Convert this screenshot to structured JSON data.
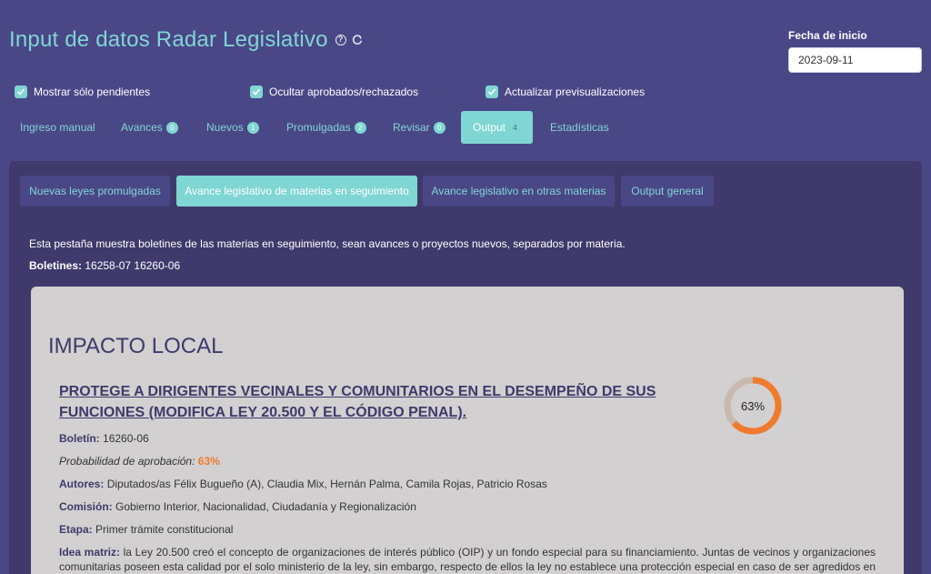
{
  "header": {
    "title": "Input de datos Radar Legislativo",
    "help_icon": "question-circle-icon",
    "refresh_icon": "refresh-icon"
  },
  "date": {
    "label": "Fecha de inicio",
    "value": "2023-09-11"
  },
  "checkboxes": [
    {
      "label": "Mostrar sólo pendientes",
      "checked": true
    },
    {
      "label": "Ocultar aprobados/rechazados",
      "checked": true
    },
    {
      "label": "Actualizar previsualizaciones",
      "checked": true
    }
  ],
  "tabs": [
    {
      "label": "Ingreso manual",
      "badge": null
    },
    {
      "label": "Avances",
      "badge": "0"
    },
    {
      "label": "Nuevos",
      "badge": "1"
    },
    {
      "label": "Promulgadas",
      "badge": "2"
    },
    {
      "label": "Revisar",
      "badge": "0"
    },
    {
      "label": "Output",
      "badge": "4",
      "active": true
    },
    {
      "label": "Estadísticas",
      "badge": null
    }
  ],
  "subtabs": [
    {
      "label": "Nuevas leyes promulgadas"
    },
    {
      "label": "Avance legislativo de materias en seguimiento",
      "active": true
    },
    {
      "label": "Avance legislativo en otras materias"
    },
    {
      "label": "Output general"
    }
  ],
  "output": {
    "description": "Esta pestaña muestra boletines de las materias en seguimiento, sean avances o proyectos nuevos, separados por materia.",
    "boletines_label": "Boletines:",
    "boletines_value": "16258-07 16260-06"
  },
  "card": {
    "heading": "IMPACTO LOCAL",
    "bill_title": "PROTEGE A DIRIGENTES VECINALES Y COMUNITARIOS EN EL DESEMPEÑO DE SUS FUNCIONES (MODIFICA LEY 20.500 Y EL CÓDIGO PENAL).",
    "boletin_label": "Boletín:",
    "boletin_value": "16260-06",
    "prob_label": "Probabilidad de aprobación:",
    "prob_value": "63%",
    "prob_fraction": 0.63,
    "donut_label": "63%",
    "autores_label": "Autores:",
    "autores_value": "Diputados/as Félix Bugueño (A), Claudia Mix, Hernán Palma, Camila Rojas, Patricio Rosas",
    "comision_label": "Comisión:",
    "comision_value": "Gobierno Interior, Nacionalidad, Ciudadanía y Regionalización",
    "etapa_label": "Etapa:",
    "etapa_value": "Primer trámite constitucional",
    "idea_label": "Idea matriz:",
    "idea_value": "la Ley 20.500 creó el concepto de organizaciones de interés público (OIP) y un fondo especial para su financiamiento. Juntas de vecinos y organizaciones comunitarias poseen esta calidad por el solo ministerio de la ley, sin embargo, respecto de ellos la ley no establece una protección especial en caso de ser agredidos en el"
  },
  "colors": {
    "background": "#4a4787",
    "accent": "#7fd6d2",
    "panel": "#3f3a6b",
    "card": "#d2d0d0",
    "probability": "#f07a2e"
  }
}
